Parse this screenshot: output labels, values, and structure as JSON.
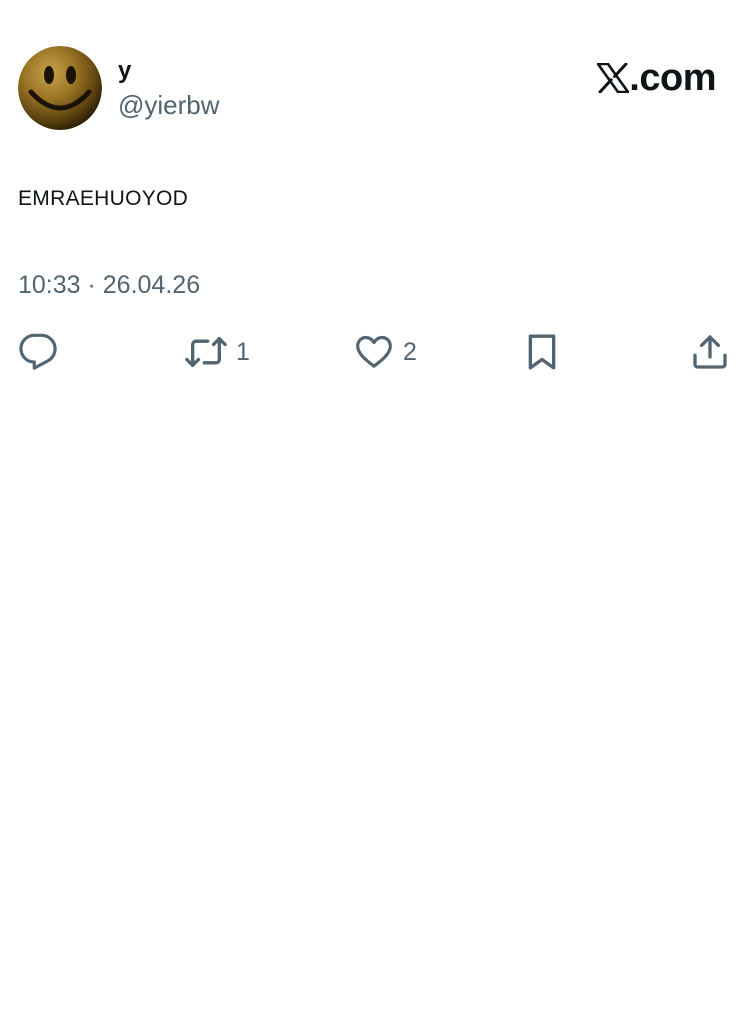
{
  "user": {
    "display_name": "y",
    "handle": "@yierbw",
    "avatar_icon": "smiley-face-icon"
  },
  "brand": {
    "text": ".com",
    "icon": "x-logo-icon"
  },
  "tweet": {
    "text": "EMRAEHUOYOD",
    "timestamp": "10:33 · 26.04.26"
  },
  "actions": {
    "reply": {
      "icon": "reply-icon",
      "count": ""
    },
    "repost": {
      "icon": "repost-icon",
      "count": "1"
    },
    "like": {
      "icon": "heart-icon",
      "count": "2"
    },
    "bookmark": {
      "icon": "bookmark-icon",
      "count": ""
    },
    "share": {
      "icon": "share-icon",
      "count": ""
    }
  },
  "colors": {
    "text_primary": "#0f1419",
    "text_secondary": "#536471",
    "icon": "#536471",
    "background": "#ffffff"
  }
}
